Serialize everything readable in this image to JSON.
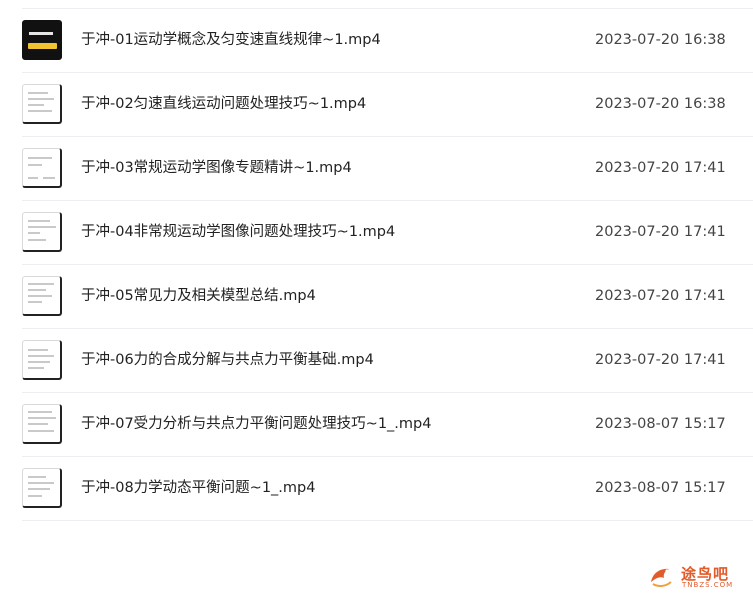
{
  "files": [
    {
      "name": "于冲-01运动学概念及匀变速直线规律~1.mp4",
      "date": "2023-07-20 16:38",
      "thumb": "dark-title"
    },
    {
      "name": "于冲-02匀速直线运动问题处理技巧~1.mp4",
      "date": "2023-07-20 16:38",
      "thumb": "document"
    },
    {
      "name": "于冲-03常规运动学图像专题精讲~1.mp4",
      "date": "2023-07-20 17:41",
      "thumb": "document"
    },
    {
      "name": "于冲-04非常规运动学图像问题处理技巧~1.mp4",
      "date": "2023-07-20 17:41",
      "thumb": "document"
    },
    {
      "name": "于冲-05常见力及相关模型总结.mp4",
      "date": "2023-07-20 17:41",
      "thumb": "document"
    },
    {
      "name": "于冲-06力的合成分解与共点力平衡基础.mp4",
      "date": "2023-07-20 17:41",
      "thumb": "document"
    },
    {
      "name": "于冲-07受力分析与共点力平衡问题处理技巧~1_.mp4",
      "date": "2023-08-07 15:17",
      "thumb": "document"
    },
    {
      "name": "于冲-08力学动态平衡问题~1_.mp4",
      "date": "2023-08-07 15:17",
      "thumb": "document"
    }
  ],
  "watermark": {
    "text": "途鸟吧",
    "sub": "TNBZS.COM",
    "color": "#e25b2b"
  }
}
